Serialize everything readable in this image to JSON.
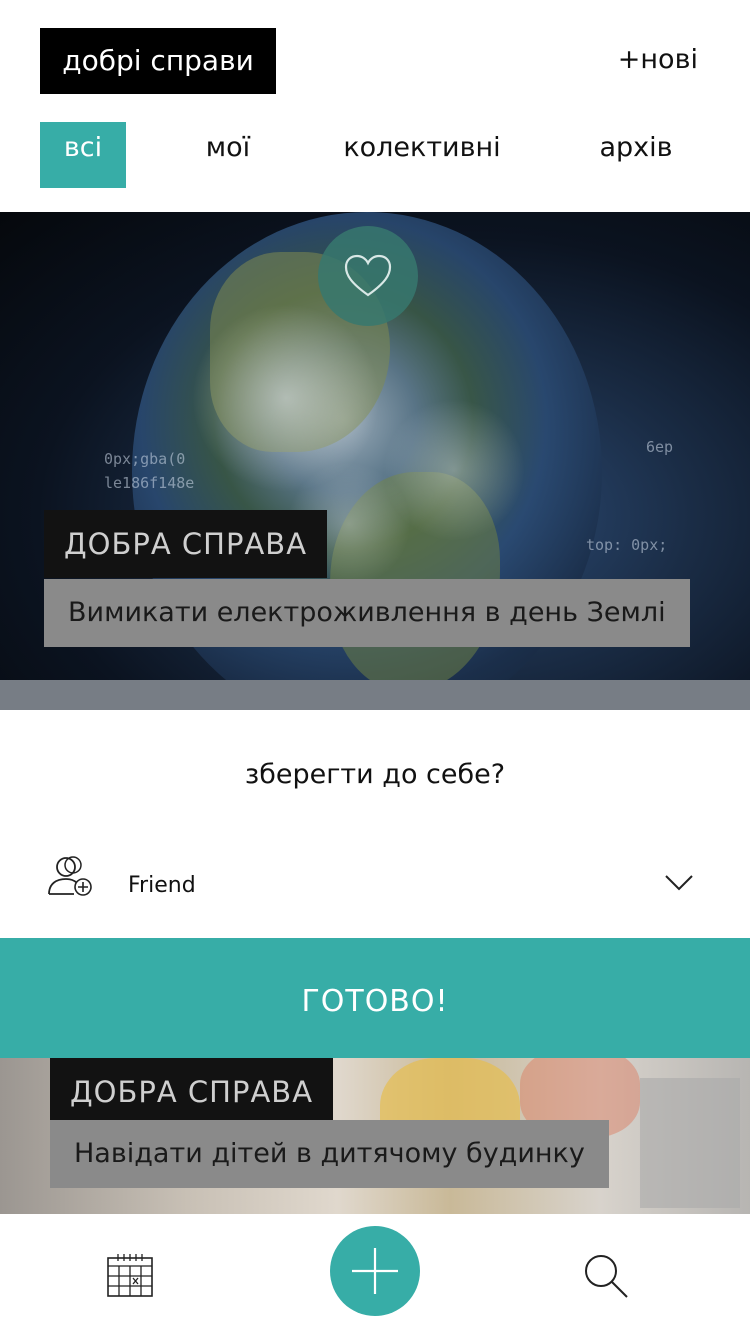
{
  "header": {
    "logo": "добрі справи",
    "new_link": "+нові",
    "tabs": [
      {
        "label": "всі",
        "active": true
      },
      {
        "label": "мої",
        "active": false
      },
      {
        "label": "колективні",
        "active": false
      },
      {
        "label": "архів",
        "active": false
      }
    ]
  },
  "cards": [
    {
      "category": "ДОБРА СПРАВА",
      "title": "Вимикати електроживлення в день Землі",
      "image": "earth-globe"
    },
    {
      "category": "ДОБРА СПРАВА",
      "title": "Навідати дітей в дитячому будинку",
      "image": "children"
    }
  ],
  "dialog": {
    "question": "зберегти до себе?",
    "select_value": "Friend",
    "submit_label": "ГОТОВО!"
  },
  "bottom_bar": {
    "icons": [
      "calendar-icon",
      "add-icon",
      "search-icon"
    ]
  },
  "colors": {
    "accent": "#37ada7",
    "dark_label": "#121212",
    "grey_label": "#8a8a8a"
  }
}
